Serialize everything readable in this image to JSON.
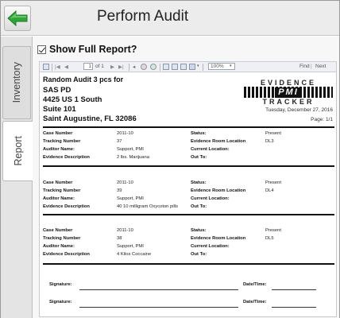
{
  "header": {
    "title": "Perform Audit"
  },
  "tabs": [
    {
      "label": "Inventory"
    },
    {
      "label": "Report"
    }
  ],
  "options": {
    "show_full_report_label": "Show Full Report?",
    "show_full_report_checked": true
  },
  "viewer_toolbar": {
    "page_input": "1",
    "page_of": "of 1",
    "zoom": "100%",
    "find_label": "Find",
    "next_label": "Next"
  },
  "report": {
    "title": "Random Audit 3 pcs  for",
    "address": [
      "SAS PD",
      "4425 US 1 South",
      "Suite 101",
      "Saint Augustine, FL 32086"
    ],
    "logo": {
      "top": "EVIDENCE",
      "middle": "PMI",
      "bottom": "TRACKER"
    },
    "date": "Tuesday, December 27, 2016",
    "page": "Page: 1/1",
    "labels": {
      "case_number": "Case Number",
      "tracking_number": "Tracking Number",
      "auditor_name": "Auditor Name:",
      "evidence_description": "Evidence Description",
      "status": "Status:",
      "evidence_room_location": "Evidence Room Location",
      "current_location": "Current Location:",
      "out_to": "Out To:"
    },
    "items": [
      {
        "case_number": "2011-10",
        "tracking_number": "37",
        "auditor_name": "Support, PMI",
        "evidence_description": "2 lbs. Marijuana",
        "status": "Present",
        "evidence_room_location": "DL3",
        "current_location": "",
        "out_to": ""
      },
      {
        "case_number": "2011-10",
        "tracking_number": "39",
        "auditor_name": "Support, PMI",
        "evidence_description": "40 10 milligram Oxycoton pills",
        "status": "Present",
        "evidence_room_location": "DL4",
        "current_location": "",
        "out_to": ""
      },
      {
        "case_number": "2011-10",
        "tracking_number": "38",
        "auditor_name": "Support, PMI",
        "evidence_description": "4 Kilos Coccaine",
        "status": "Present",
        "evidence_room_location": "DL5",
        "current_location": "",
        "out_to": ""
      }
    ],
    "signatures": {
      "signature_label": "Signature:",
      "datetime_label": "Date/Time:"
    }
  },
  "colors": {
    "back_arrow": "#2fa63a",
    "back_arrow_dark": "#1d7a26"
  },
  "icons": {
    "back": "back-arrow-icon"
  }
}
